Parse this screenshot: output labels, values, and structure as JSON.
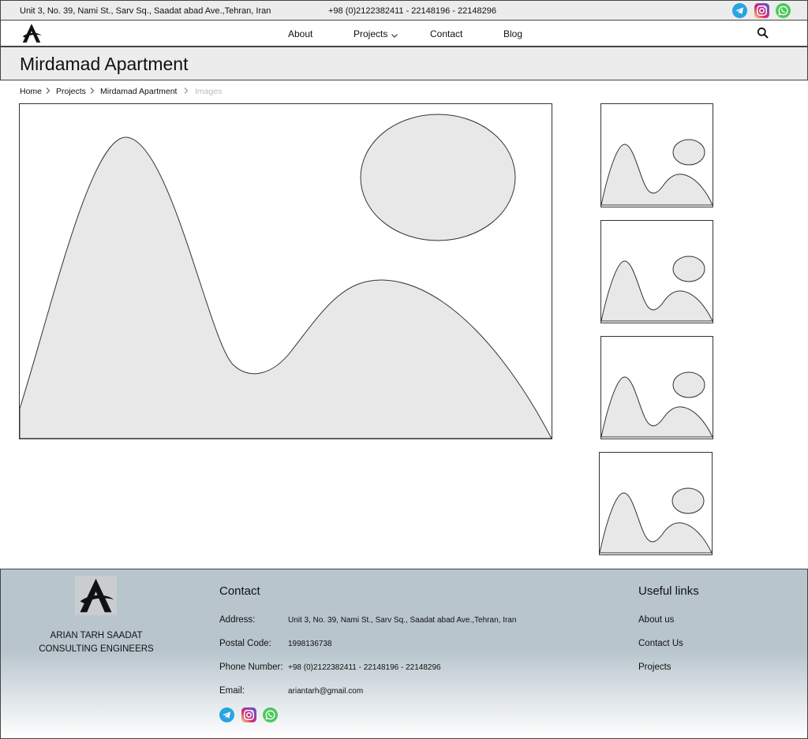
{
  "topbar": {
    "address": "Unit 3, No. 39, Nami St., Sarv Sq., Saadat abad Ave.,Tehran, Iran",
    "phone": "+98 (0)2122382411 - 22148196 - 22148296",
    "social": [
      {
        "icon": "telegram-icon",
        "color": "#2aa3e2"
      },
      {
        "icon": "instagram-icon",
        "color": "#d62976"
      },
      {
        "icon": "whatsapp-icon",
        "color": "#4cc95d"
      }
    ]
  },
  "nav": {
    "items": [
      "About",
      "Projects",
      "Contact",
      "Blog"
    ],
    "search_icon": "search-icon"
  },
  "page": {
    "title": "Mirdamad Apartment"
  },
  "breadcrumb": [
    "Home",
    "Projects",
    "Mirdamad Apartment",
    "Images"
  ],
  "gallery": {
    "main_image": "image-placeholder",
    "thumbnails": [
      "image-placeholder",
      "image-placeholder",
      "image-placeholder",
      "image-placeholder"
    ]
  },
  "footer": {
    "company_line1": "ARIAN TARH SAADAT",
    "company_line2": "CONSULTING ENGINEERS",
    "contact_heading": "Contact",
    "contact": [
      {
        "label": "Address:",
        "value": "Unit 3, No. 39, Nami St., Sarv Sq., Saadat abad Ave.,Tehran, Iran"
      },
      {
        "label": "Postal Code:",
        "value": "1998136738"
      },
      {
        "label": "Phone Number:",
        "value": "+98 (0)2122382411 - 22148196 - 22148296"
      },
      {
        "label": "Email:",
        "value": "ariantarh@gmail.com"
      }
    ],
    "links_heading": "Useful links",
    "links": [
      "About us",
      "Contact Us",
      "Projects"
    ]
  }
}
